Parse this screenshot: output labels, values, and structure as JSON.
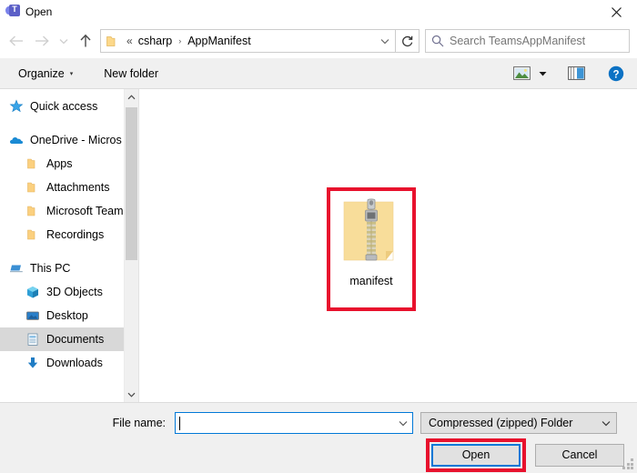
{
  "window": {
    "title": "Open",
    "app_icon": "teams-icon",
    "close_label": "✕",
    "accent_blue": "#0078d7",
    "annotation_red": "#e8112d"
  },
  "navigation": {
    "back": "←",
    "forward": "→",
    "recent": "∨",
    "up": "↑",
    "refresh": "↻"
  },
  "address_bar": {
    "folder_icon": "folder-icon",
    "overflow": "«",
    "crumbs": [
      {
        "label": "csharp"
      },
      {
        "label": "AppManifest"
      }
    ],
    "separator": "›",
    "dropdown": "∨"
  },
  "search": {
    "icon": "search-icon",
    "placeholder": "Search TeamsAppManifest",
    "value": ""
  },
  "toolbar": {
    "organize_label": "Organize",
    "organize_caret": "▾",
    "new_folder_label": "New folder",
    "view_icon": "view-options-icon",
    "view_caret": "▾",
    "preview_pane_icon": "preview-pane-icon",
    "help_icon": "help-icon",
    "help_glyph": "?"
  },
  "sidebar": {
    "items": [
      {
        "label": "Quick access",
        "icon": "star-icon",
        "level": 0,
        "selected": false
      },
      {
        "label": "OneDrive - Micros",
        "icon": "onedrive-cloud-icon",
        "level": 0,
        "selected": false
      },
      {
        "label": "Apps",
        "icon": "folder-icon",
        "level": 1,
        "selected": false
      },
      {
        "label": "Attachments",
        "icon": "folder-icon",
        "level": 1,
        "selected": false
      },
      {
        "label": "Microsoft Teams",
        "icon": "folder-icon",
        "level": 1,
        "selected": false
      },
      {
        "label": "Recordings",
        "icon": "folder-icon",
        "level": 1,
        "selected": false
      },
      {
        "label": "This PC",
        "icon": "computer-icon",
        "level": 0,
        "selected": false
      },
      {
        "label": "3D Objects",
        "icon": "cube-icon",
        "level": 1,
        "selected": false
      },
      {
        "label": "Desktop",
        "icon": "desktop-icon",
        "level": 1,
        "selected": false
      },
      {
        "label": "Documents",
        "icon": "documents-icon",
        "level": 1,
        "selected": true
      },
      {
        "label": "Downloads",
        "icon": "download-icon",
        "level": 1,
        "selected": false
      }
    ],
    "scroll_up": "∧",
    "scroll_down": "∨"
  },
  "file_list": {
    "items": [
      {
        "name": "manifest",
        "icon": "zipped-folder-icon",
        "highlighted": true
      }
    ]
  },
  "footer": {
    "filename_label": "File name:",
    "filename_value": "",
    "filename_dropdown": "∨",
    "filetype_value": "Compressed (zipped) Folder",
    "filetype_dropdown": "∨",
    "open_label": "Open",
    "open_highlighted": true,
    "cancel_label": "Cancel",
    "resize_grip": "resize-grip"
  }
}
